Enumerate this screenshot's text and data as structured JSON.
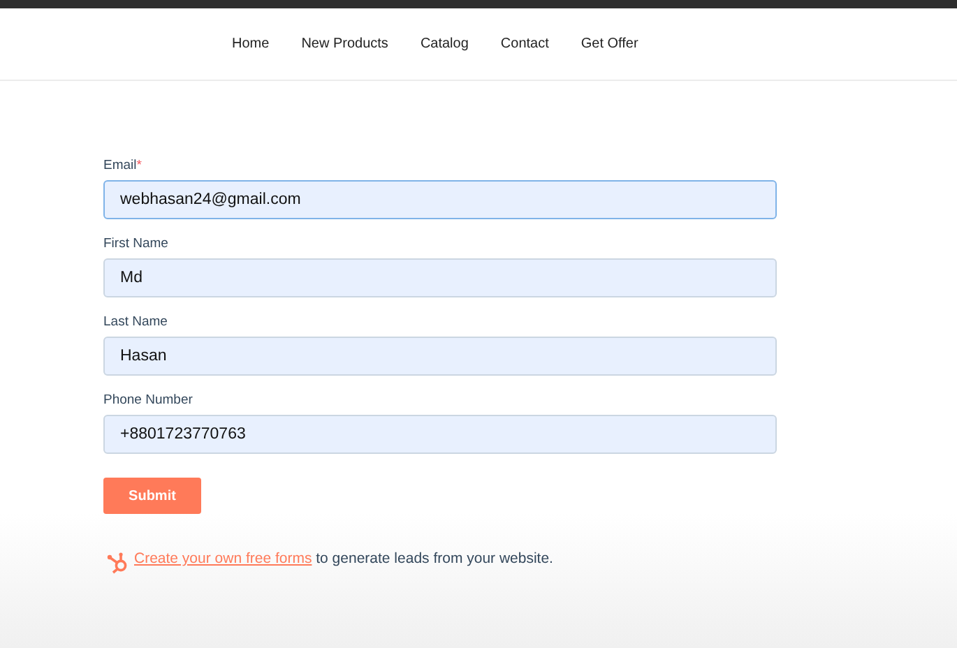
{
  "nav": {
    "items": [
      {
        "label": "Home"
      },
      {
        "label": "New Products"
      },
      {
        "label": "Catalog"
      },
      {
        "label": "Contact"
      },
      {
        "label": "Get Offer"
      }
    ]
  },
  "form": {
    "fields": [
      {
        "label": "Email",
        "required_mark": "*",
        "value": "webhasan24@gmail.com",
        "focused": true
      },
      {
        "label": "First Name",
        "value": "Md",
        "focused": false
      },
      {
        "label": "Last Name",
        "value": "Hasan",
        "focused": false
      },
      {
        "label": "Phone Number",
        "value": "+8801723770763",
        "focused": false
      }
    ],
    "submit": "Submit"
  },
  "footer": {
    "link": "Create your own free forms",
    "text": " to generate leads from your website."
  }
}
